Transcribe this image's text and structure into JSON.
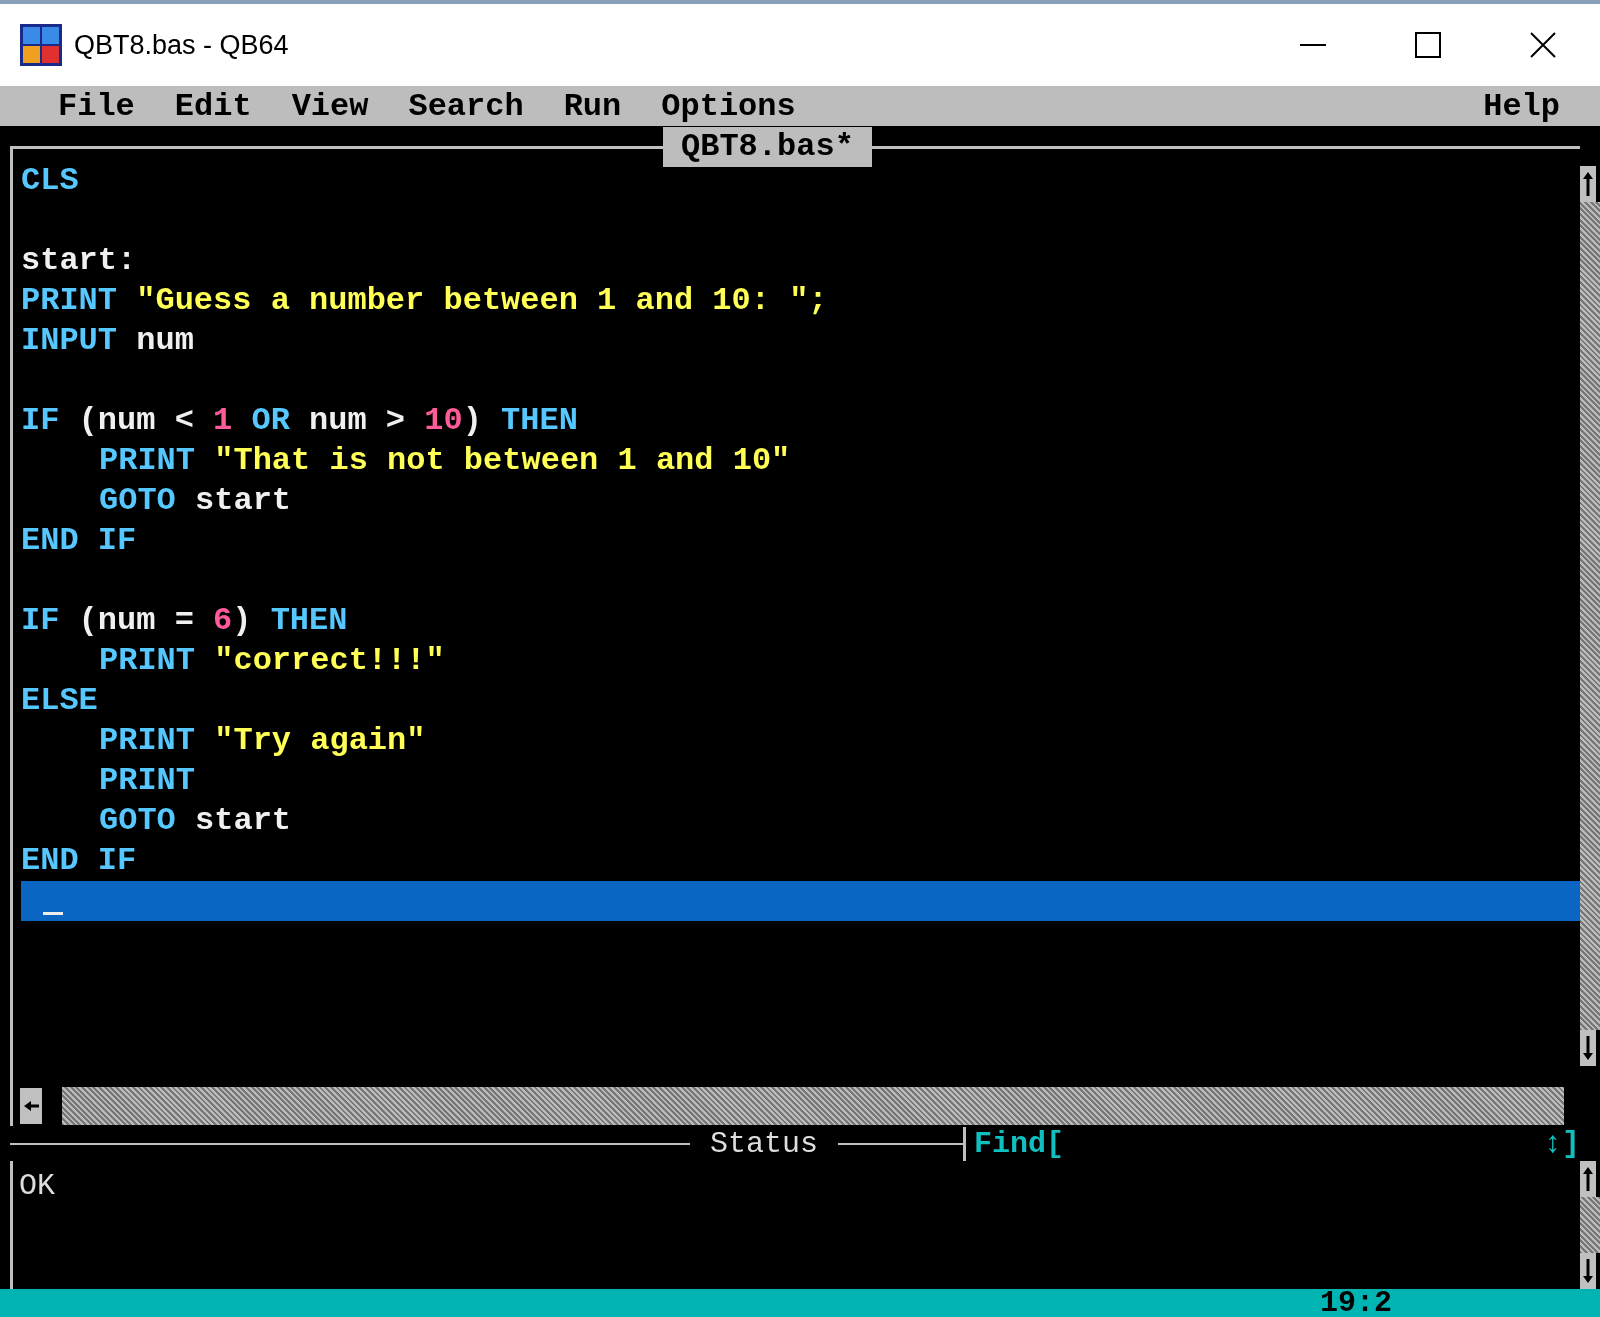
{
  "window": {
    "title": "QBT8.bas - QB64"
  },
  "menu": {
    "items": [
      {
        "label": "File"
      },
      {
        "label": "Edit"
      },
      {
        "label": "View"
      },
      {
        "label": "Search"
      },
      {
        "label": "Run"
      },
      {
        "label": "Options"
      }
    ],
    "help": "Help"
  },
  "editor": {
    "title": "QBT8.bas*",
    "blocks": [
      {
        "lines": [
          {
            "indented": false,
            "current": false,
            "tokens": [
              {
                "kind": "keyword",
                "text": "CLS"
              }
            ]
          }
        ]
      },
      {
        "lines": [
          {
            "indented": false,
            "current": false,
            "tokens": [
              {
                "kind": "plain",
                "text": "start:"
              }
            ]
          },
          {
            "indented": false,
            "current": false,
            "tokens": [
              {
                "kind": "keyword",
                "text": "PRINT"
              },
              {
                "kind": "string",
                "text": " \"Guess a number between 1 and 10: \";"
              }
            ]
          },
          {
            "indented": false,
            "current": false,
            "tokens": [
              {
                "kind": "keyword",
                "text": "INPUT"
              },
              {
                "kind": "plain",
                "text": " num"
              }
            ]
          }
        ]
      },
      {
        "lines": [
          {
            "indented": false,
            "current": false,
            "tokens": [
              {
                "kind": "keyword",
                "text": "IF"
              },
              {
                "kind": "plain",
                "text": " (num < "
              },
              {
                "kind": "number",
                "text": "1"
              },
              {
                "kind": "keyword",
                "text": " OR"
              },
              {
                "kind": "plain",
                "text": " num > "
              },
              {
                "kind": "number",
                "text": "10"
              },
              {
                "kind": "plain",
                "text": ") "
              },
              {
                "kind": "keyword",
                "text": "THEN"
              }
            ]
          },
          {
            "indented": true,
            "current": false,
            "tokens": [
              {
                "kind": "keyword",
                "text": "PRINT"
              },
              {
                "kind": "string",
                "text": " \"That is not between 1 and 10\""
              }
            ]
          },
          {
            "indented": true,
            "current": false,
            "tokens": [
              {
                "kind": "keyword",
                "text": "GOTO"
              },
              {
                "kind": "plain",
                "text": " start"
              }
            ]
          },
          {
            "indented": false,
            "current": false,
            "tokens": [
              {
                "kind": "keyword",
                "text": "END IF"
              }
            ]
          }
        ]
      },
      {
        "lines": [
          {
            "indented": false,
            "current": false,
            "tokens": [
              {
                "kind": "keyword",
                "text": "IF"
              },
              {
                "kind": "plain",
                "text": " (num = "
              },
              {
                "kind": "number",
                "text": "6"
              },
              {
                "kind": "plain",
                "text": ") "
              },
              {
                "kind": "keyword",
                "text": "THEN"
              }
            ]
          },
          {
            "indented": true,
            "current": false,
            "tokens": [
              {
                "kind": "keyword",
                "text": "PRINT"
              },
              {
                "kind": "string",
                "text": " \"correct!!!\""
              }
            ]
          },
          {
            "indented": false,
            "current": false,
            "tokens": [
              {
                "kind": "keyword",
                "text": "ELSE"
              }
            ]
          },
          {
            "indented": true,
            "current": false,
            "tokens": [
              {
                "kind": "keyword",
                "text": "PRINT"
              },
              {
                "kind": "string",
                "text": " \"Try again\""
              }
            ]
          },
          {
            "indented": true,
            "current": false,
            "tokens": [
              {
                "kind": "keyword",
                "text": "PRINT"
              }
            ]
          },
          {
            "indented": true,
            "current": false,
            "tokens": [
              {
                "kind": "keyword",
                "text": "GOTO"
              },
              {
                "kind": "plain",
                "text": " start"
              }
            ]
          },
          {
            "indented": false,
            "current": false,
            "tokens": [
              {
                "kind": "keyword",
                "text": "END IF"
              }
            ]
          },
          {
            "indented": false,
            "current": true
          }
        ]
      }
    ]
  },
  "status_panel": {
    "title": "Status",
    "find_label": "Find[",
    "find_end": "↕]",
    "message": "OK"
  },
  "status_bar": {
    "position": "19:2"
  }
}
